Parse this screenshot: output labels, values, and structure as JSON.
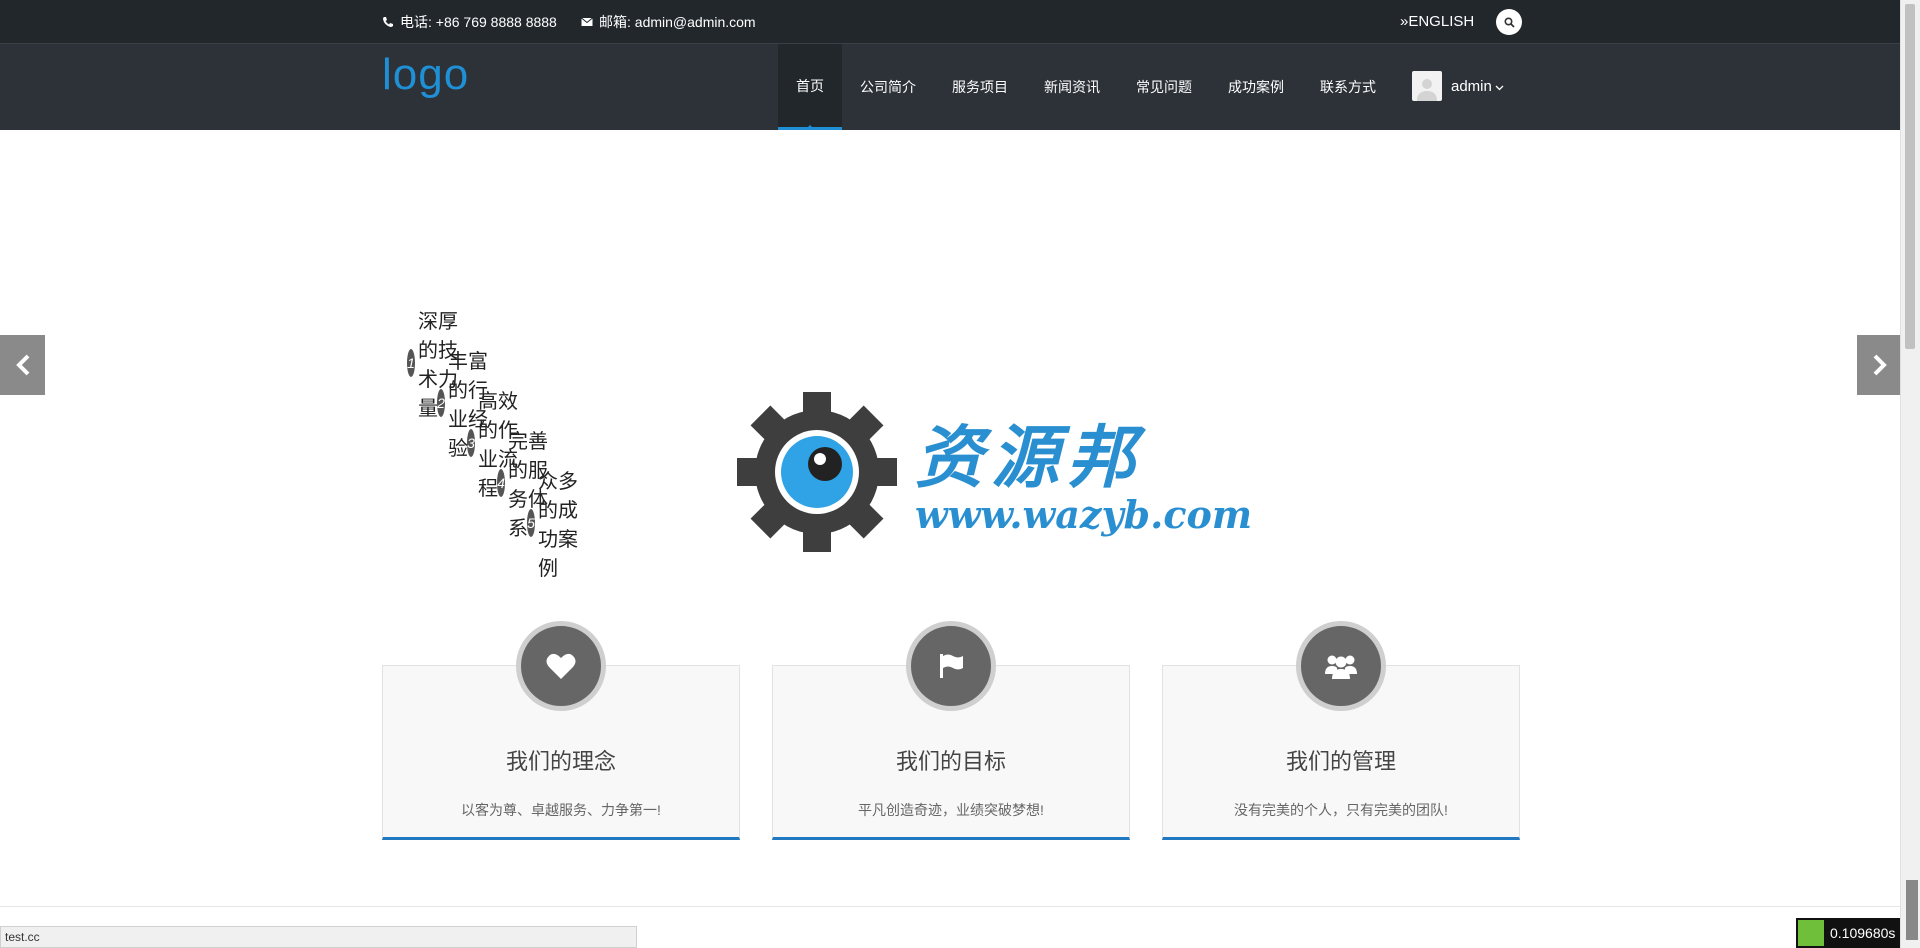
{
  "topbar": {
    "phone": "电话: +86 769 8888 8888",
    "email": "邮箱: admin@admin.com",
    "language": "»ENGLISH"
  },
  "nav": {
    "logo": "logo",
    "items": [
      {
        "label": "首页",
        "active": true
      },
      {
        "label": "公司简介"
      },
      {
        "label": "服务项目"
      },
      {
        "label": "新闻资讯"
      },
      {
        "label": "常见问题"
      },
      {
        "label": "成功案例"
      },
      {
        "label": "联系方式"
      }
    ],
    "user": "admin"
  },
  "slider": {
    "features": [
      {
        "num": "1",
        "text": "深厚的技术力量"
      },
      {
        "num": "2",
        "text": "丰富的行业经验"
      },
      {
        "num": "3",
        "text": "高效的作业流程"
      },
      {
        "num": "4",
        "text": "完善的服务体系"
      },
      {
        "num": "5",
        "text": "众多的成功案例"
      }
    ],
    "watermark_title": "资源邦",
    "watermark_url": "www.wazyb.com"
  },
  "cards": [
    {
      "icon": "heart-icon",
      "title": "我们的理念",
      "desc": "以客为尊、卓越服务、力争第一!"
    },
    {
      "icon": "flag-icon",
      "title": "我们的目标",
      "desc": "平凡创造奇迹，业绩突破梦想!"
    },
    {
      "icon": "users-icon",
      "title": "我们的管理",
      "desc": "没有完美的个人，只有完美的团队!"
    }
  ],
  "statusbar": {
    "url": "test.cc"
  },
  "timer": {
    "value": "0.109680s"
  },
  "colors": {
    "accent": "#1f8fd6",
    "topbar": "#22272c",
    "navbar": "#2c3238"
  }
}
